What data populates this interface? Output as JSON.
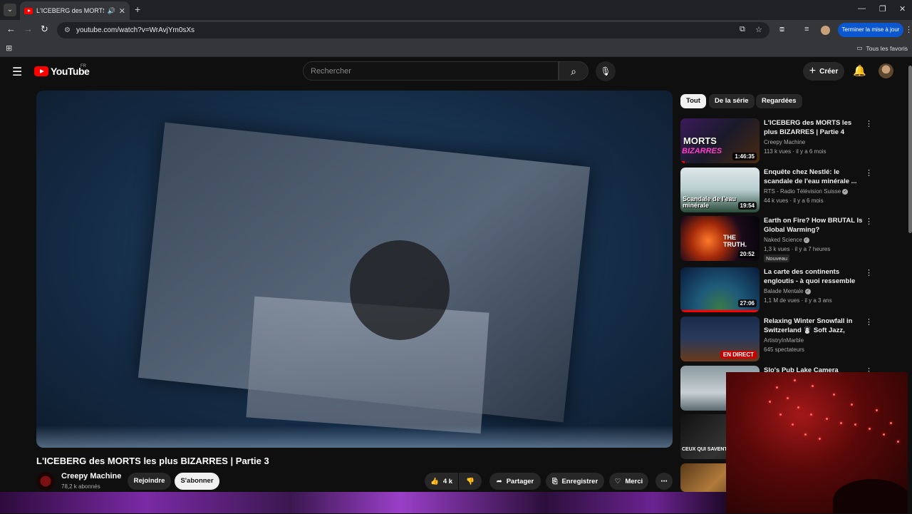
{
  "browser": {
    "tab_title": "L'ICEBERG des MORTS les plus BIZARRES | Partie 3",
    "url": "youtube.com/watch?v=WrAvjYm0sXs",
    "update_button": "Terminer la mise à jour",
    "bookmarks_all": "Tous les favoris"
  },
  "header": {
    "logo_text": "YouTube",
    "country": "FR",
    "search_placeholder": "Rechercher",
    "create_label": "Créer"
  },
  "video": {
    "title": "L'ICEBERG des MORTS les plus BIZARRES | Partie 3",
    "channel_name": "Creepy Machine",
    "subscribers": "78,2 k abonnés",
    "join_label": "Rejoindre",
    "subscribe_label": "S'abonner",
    "likes": "4 k",
    "share_label": "Partager",
    "save_label": "Enregistrer",
    "thanks_label": "Merci"
  },
  "chips": [
    "Tout",
    "De la série",
    "Regardées"
  ],
  "recommended": [
    {
      "title": "L'ICEBERG des MORTS les plus BIZARRES | Partie 4",
      "channel": "Creepy Machine",
      "meta": "113 k vues · il y a 6 mois",
      "duration": "1:46:35",
      "progress": 0.05
    },
    {
      "title": "Enquête chez Nestlé: le scandale de l'eau minérale ...",
      "channel": "RTS - Radio Télévision Suisse",
      "meta": "44 k vues · il y a 6 mois",
      "duration": "19:54"
    },
    {
      "title": "Earth on Fire? How BRUTAL Is Global Warming?",
      "channel": "Naked Science",
      "meta": "1,3 k vues · il y a 7 heures",
      "duration": "20:52",
      "badge": "Nouveau"
    },
    {
      "title": "La carte des continents engloutis - à quoi ressemble la...",
      "channel": "Balade Mentale",
      "meta": "1,1 M de vues · il y a 3 ans",
      "duration": "27:06",
      "progress": 1.0
    },
    {
      "title": "Relaxing Winter Snowfall in Switzerland ☃️ Soft Jazz, Coz...",
      "channel": "ArtistryInMarble",
      "meta": "645 spectateurs",
      "live": "EN DIRECT"
    },
    {
      "title": "Slo's Pub Lake Camera",
      "channel": "",
      "meta": ""
    }
  ],
  "thumb_texts": {
    "t1": "MORTS",
    "t1b": "BIZARRES",
    "t2": "Scandale de l'eau minérale",
    "t3": "THE TRUTH.",
    "t7": "CEUX QUI SAVENT"
  },
  "colors": {
    "accent": "#ff0000",
    "background": "#0f0f0f",
    "update_blue": "#0b57d0"
  }
}
